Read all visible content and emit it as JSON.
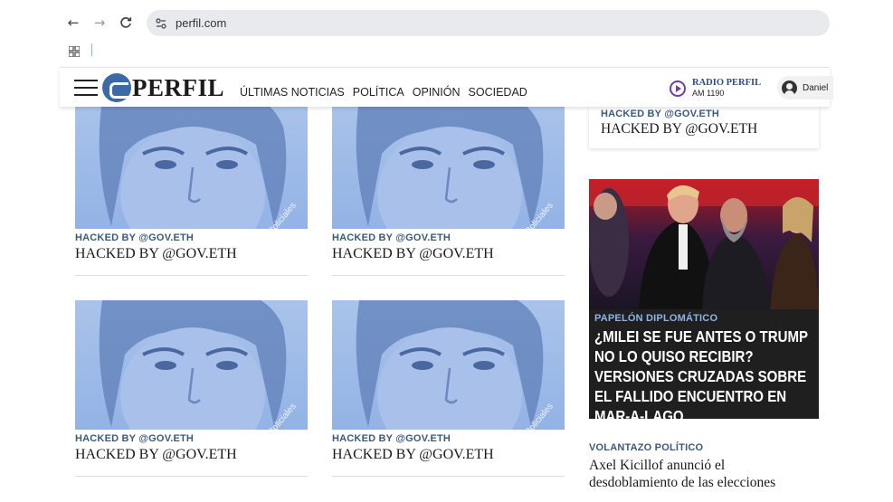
{
  "browser": {
    "url": "perfil.com",
    "back_icon": "arrow-left-icon",
    "forward_icon": "arrow-right-icon",
    "reload_icon": "reload-icon",
    "site_info_icon": "tune-icon",
    "apps_icon": "apps-grid-icon"
  },
  "header": {
    "logo_text": "PERFIL",
    "nav": [
      "ÚLTIMAS NOTICIAS",
      "POLÍTICA",
      "OPINIÓN",
      "SOCIEDAD"
    ],
    "radio_name": "RADIO PERFIL",
    "radio_freq": "AM 1190",
    "user_name": "Daniel",
    "brand_color": "#3b6aa8",
    "radio_color": "#6f3ea6"
  },
  "cards": [
    {
      "kicker": "HACKED BY @GOV.ETH",
      "headline": "HACKED BY @GOV.ETH",
      "watermark": "Comunicaciones Policiales"
    },
    {
      "kicker": "HACKED BY @GOV.ETH",
      "headline": "HACKED BY @GOV.ETH",
      "watermark": "Comunicaciones Policiales"
    },
    {
      "kicker": "HACKED BY @GOV.ETH",
      "headline": "HACKED BY @GOV.ETH",
      "watermark": "Comunicaciones Policiales"
    },
    {
      "kicker": "HACKED BY @GOV.ETH",
      "headline": "HACKED BY @GOV.ETH",
      "watermark": "Comunicaciones Policiales"
    }
  ],
  "sidebar": {
    "top": {
      "kicker": "HACKED BY @GOV.ETH",
      "headline": "HACKED BY @GOV.ETH"
    },
    "feature": {
      "kicker": "PAPELÓN DIPLOMÁTICO",
      "headline": "¿Milei se fue antes o Trump no lo quiso recibir? Versiones cruzadas sobre el fallido encuentro en Mar-a-Lago"
    },
    "bottom": {
      "kicker": "VOLANTAZO POLÍTICO",
      "headline_line1": "Axel Kicillof anunció el",
      "headline_line2": "desdoblamiento de las elecciones"
    }
  }
}
